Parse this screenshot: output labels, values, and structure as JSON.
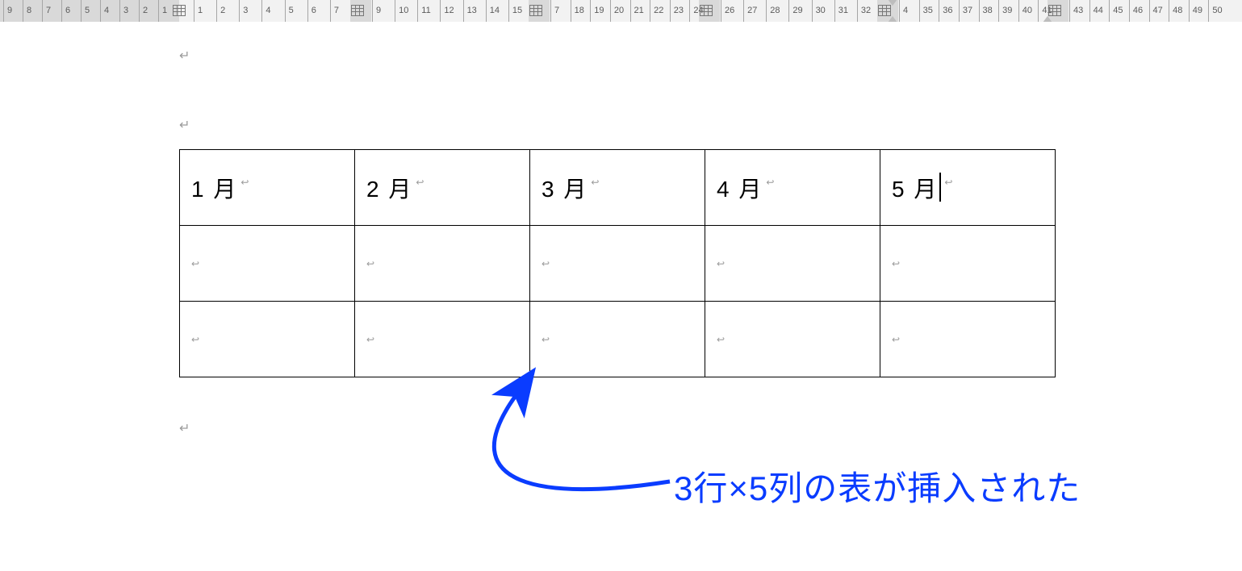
{
  "ruler": {
    "left_margin_ticks": [
      "9",
      "8",
      "7",
      "6",
      "5",
      "4",
      "3",
      "2",
      "1"
    ],
    "segments": [
      {
        "start_label": "",
        "ticks": [
          "1",
          "2",
          "3",
          "4",
          "5",
          "6",
          "7"
        ]
      },
      {
        "start_label": "",
        "ticks": [
          "9",
          "10",
          "11",
          "12",
          "13",
          "14",
          "15"
        ]
      },
      {
        "start_label": "",
        "ticks": [
          "7",
          "18",
          "19",
          "20",
          "21",
          "22",
          "23",
          "24"
        ]
      },
      {
        "start_label": "",
        "ticks": [
          "26",
          "27",
          "28",
          "29",
          "30",
          "31",
          "32"
        ]
      },
      {
        "start_label": "",
        "ticks": [
          "4",
          "35",
          "36",
          "37",
          "38",
          "39",
          "40",
          "41"
        ]
      },
      {
        "start_label": "",
        "ticks": [
          "43",
          "44",
          "45",
          "46",
          "47",
          "48",
          "49",
          "50"
        ]
      }
    ]
  },
  "table": {
    "rows": 3,
    "cols": 5,
    "cells": [
      [
        "1 月",
        "2 月",
        "3 月",
        "4 月",
        "5 月"
      ],
      [
        "",
        "",
        "",
        "",
        ""
      ],
      [
        "",
        "",
        "",
        "",
        ""
      ]
    ],
    "cursor": {
      "row": 0,
      "col": 4
    }
  },
  "captions": {
    "c1": "3行×5列の表が挿入された"
  },
  "colors": {
    "annotation": "#0a3cff"
  },
  "marks": {
    "para": "↩"
  }
}
